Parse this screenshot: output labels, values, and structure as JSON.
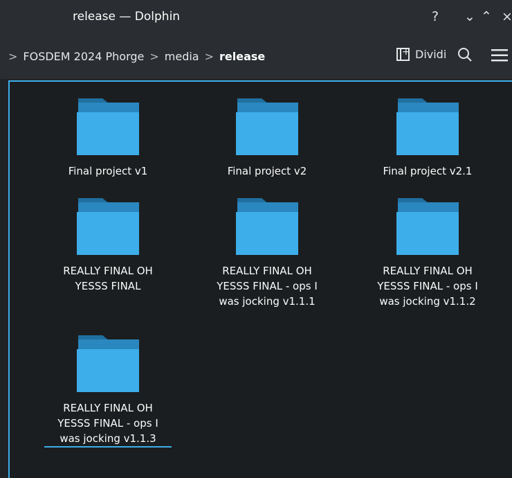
{
  "window": {
    "title": "release — Dolphin",
    "help_glyph": "?",
    "minimize_glyph": "⌄",
    "maximize_glyph": "⌃",
    "close_glyph": "×"
  },
  "breadcrumb": {
    "leading_sep": ">",
    "items": [
      "FOSDEM 2024 Phorge",
      "media",
      "release"
    ],
    "sep": ">"
  },
  "toolbar": {
    "split_label": "Dividi",
    "search_icon": "search-icon",
    "menu_icon": "hamburger-menu-icon"
  },
  "colors": {
    "accent": "#3daee9",
    "folder_body": "#3daee9",
    "folder_tab": "#1f6fa0",
    "background": "#1b1e20"
  },
  "files": [
    {
      "name": "Final project v1"
    },
    {
      "name": "Final project v2"
    },
    {
      "name": "Final project v2.1"
    },
    {
      "name": "REALLY FINAL OH YESSS FINAL"
    },
    {
      "name": "REALLY FINAL OH YESSS FINAL - ops I was jocking v1.1.1"
    },
    {
      "name": "REALLY FINAL OH YESSS FINAL - ops I was jocking v1.1.2"
    },
    {
      "name": "REALLY FINAL OH YESSS FINAL - ops I was jocking v1.1.3"
    }
  ]
}
